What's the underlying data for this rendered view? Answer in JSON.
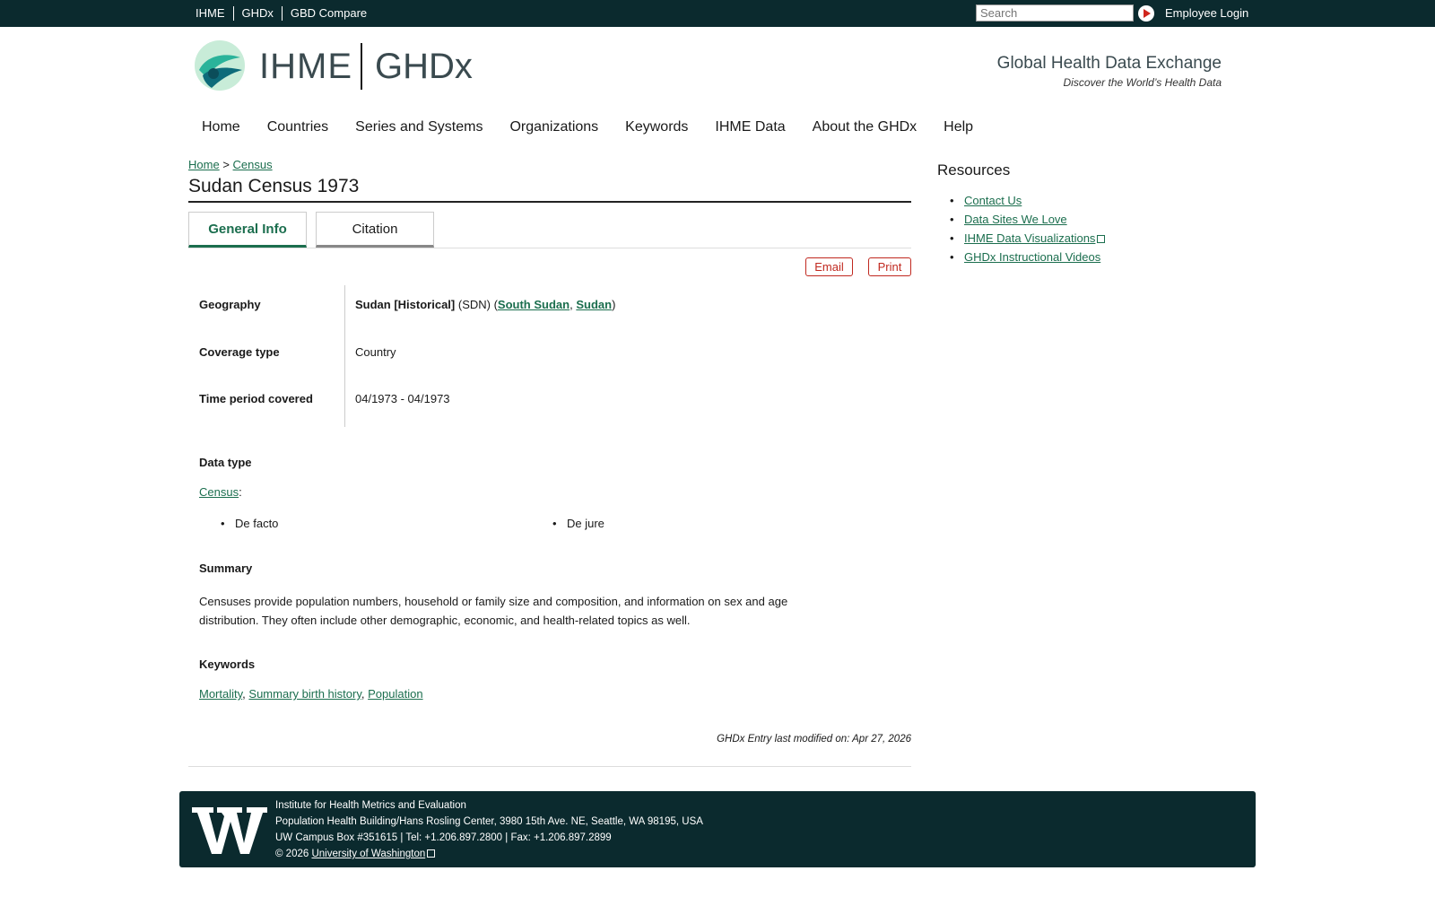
{
  "topbar": {
    "links": [
      "IHME",
      "GHDx",
      "GBD Compare"
    ],
    "search_placeholder": "Search",
    "employee_login": "Employee Login"
  },
  "header": {
    "logo_left": "IHME",
    "logo_right": "GHDx",
    "tagline": "Global Health Data Exchange",
    "subtagline": "Discover the World’s Health Data"
  },
  "nav": [
    "Home",
    "Countries",
    "Series and Systems",
    "Organizations",
    "Keywords",
    "IHME Data",
    "About the GHDx",
    "Help"
  ],
  "breadcrumb": {
    "home": "Home",
    "sep": ">",
    "current": "Census"
  },
  "page_title": "Sudan Census 1973",
  "tabs": {
    "general": "General Info",
    "citation": "Citation"
  },
  "actions": {
    "email": "Email",
    "print": "Print"
  },
  "fields": {
    "geography_label": "Geography",
    "geography_name": "Sudan [Historical]",
    "geography_code": "(SDN) (",
    "geography_link1": "South Sudan",
    "geography_comma": ",",
    "geography_link2": "Sudan",
    "geography_close": ")",
    "coverage_label": "Coverage type",
    "coverage_value": "Country",
    "time_label": "Time period covered",
    "time_value": "04/1973 - 04/1973"
  },
  "data_type": {
    "heading": "Data type",
    "link": "Census",
    "colon": ":",
    "items": [
      "De facto",
      "De jure"
    ]
  },
  "summary": {
    "heading": "Summary",
    "text": "Censuses provide population numbers, household or family size and composition, and information on sex and age distribution. They often include other demographic, economic, and health-related topics as well."
  },
  "keywords": {
    "heading": "Keywords",
    "items": [
      "Mortality",
      "Summary birth history",
      "Population"
    ],
    "sep": ","
  },
  "modified": "GHDx Entry last modified on: Apr 27, 2026",
  "resources": {
    "title": "Resources",
    "items": [
      "Contact Us",
      "Data Sites We Love",
      "IHME Data Visualizations",
      "GHDx Instructional Videos"
    ]
  },
  "footer": {
    "line1": "Institute for Health Metrics and Evaluation",
    "line2": "Population Health Building/Hans Rosling Center, 3980 15th Ave. NE, Seattle, WA 98195, USA",
    "line3": "UW Campus Box #351615 | Tel: +1.206.897.2800 | Fax: +1.206.897.2899",
    "copyright": "© 2026",
    "uw_link": "University of Washington"
  },
  "colors": {
    "topbar_bg": "#0b2a2e",
    "link_green": "#1b6e4e",
    "action_red": "#c0281f"
  }
}
